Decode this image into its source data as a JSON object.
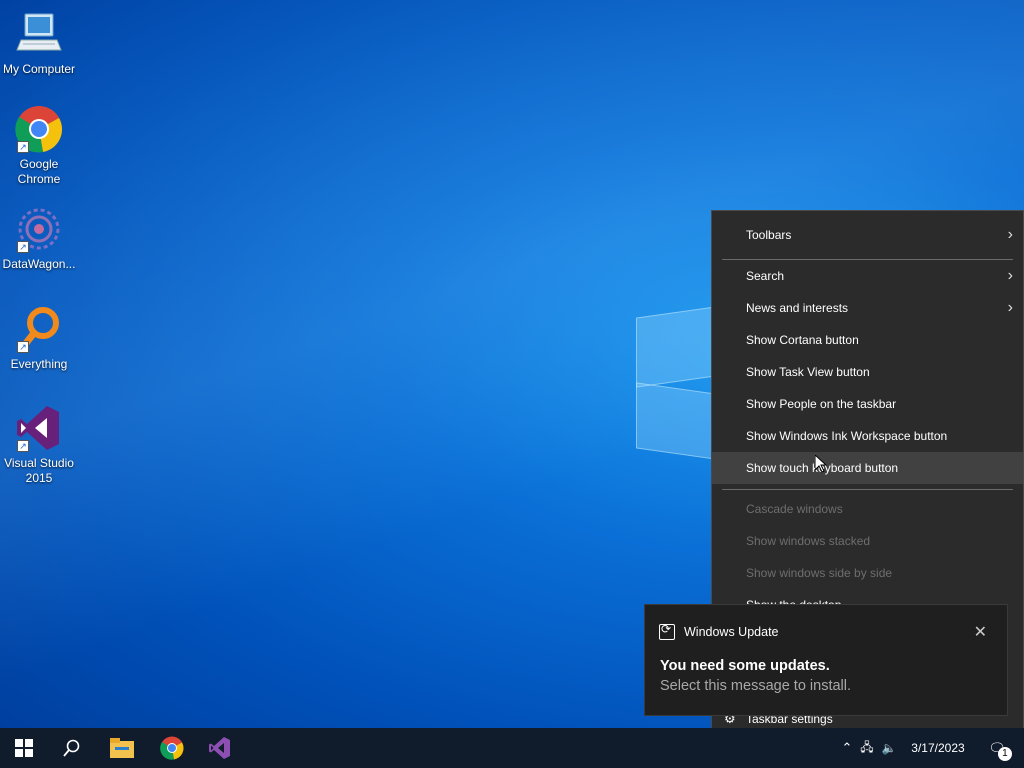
{
  "desktop": {
    "icons": [
      {
        "label": "My Computer",
        "icon": "computer-icon"
      },
      {
        "label": "Google Chrome",
        "icon": "chrome-icon"
      },
      {
        "label": "DataWagon...",
        "icon": "datawagon-icon"
      },
      {
        "label": "Everything",
        "icon": "everything-search-icon"
      },
      {
        "label": "Visual Studio 2015",
        "icon": "visual-studio-icon"
      }
    ]
  },
  "context_menu": {
    "items": [
      {
        "label": "Toolbars",
        "submenu": true,
        "disabled": false
      },
      {
        "label": "Search",
        "submenu": true,
        "disabled": false
      },
      {
        "label": "News and interests",
        "submenu": true,
        "disabled": false
      },
      {
        "label": "Show Cortana button",
        "submenu": false,
        "disabled": false
      },
      {
        "label": "Show Task View button",
        "submenu": false,
        "disabled": false
      },
      {
        "label": "Show People on the taskbar",
        "submenu": false,
        "disabled": false
      },
      {
        "label": "Show Windows Ink Workspace button",
        "submenu": false,
        "disabled": false
      },
      {
        "label": "Show touch keyboard button",
        "submenu": false,
        "disabled": false,
        "hovered": true
      },
      {
        "label": "Cascade windows",
        "submenu": false,
        "disabled": true
      },
      {
        "label": "Show windows stacked",
        "submenu": false,
        "disabled": true
      },
      {
        "label": "Show windows side by side",
        "submenu": false,
        "disabled": true
      },
      {
        "label": "Show the desktop",
        "submenu": false,
        "disabled": false
      },
      {
        "label": "Taskbar settings",
        "submenu": false,
        "disabled": false,
        "icon": "gear-icon"
      }
    ],
    "chevron": "›"
  },
  "toast": {
    "app": "Windows Update",
    "close": "✕",
    "title": "You need some updates.",
    "body": "Select this message to install."
  },
  "taskbar": {
    "date": "3/17/2023",
    "notification_count": "1",
    "pinned": [
      "start-icon",
      "search-icon",
      "file-explorer-icon",
      "chrome-icon",
      "visual-studio-icon"
    ]
  },
  "colors": {
    "menu_bg": "#2b2b2b",
    "taskbar_bg": "#101b2b",
    "desktop_accent": "#0a6fd6"
  }
}
